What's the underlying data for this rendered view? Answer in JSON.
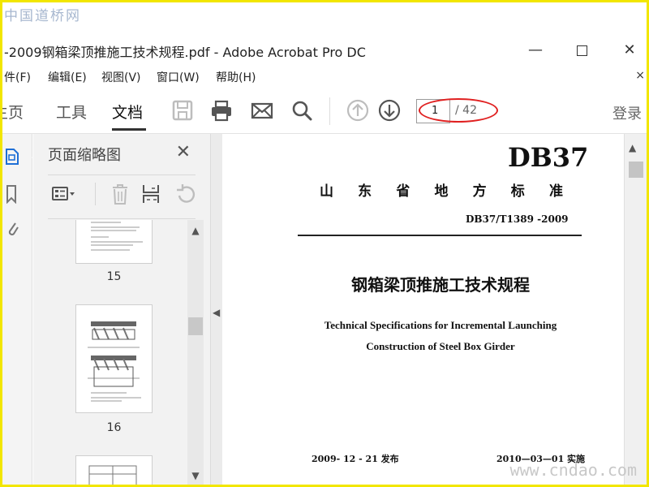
{
  "watermarks": {
    "top_left": "中国道桥网",
    "bottom_right": "www.cndao.com"
  },
  "window": {
    "title": "-2009钢箱梁顶推施工技术规程.pdf - Adobe Acrobat Pro DC",
    "minimize": "—",
    "close": "✕"
  },
  "menu": {
    "items": [
      "件(F)",
      "编辑(E)",
      "视图(V)",
      "窗口(W)",
      "帮助(H)"
    ],
    "close": "×"
  },
  "toolbar": {
    "tabs": [
      "主页",
      "工具",
      "文档"
    ],
    "active_tab": "文档",
    "tools": [
      "save-icon",
      "print-icon",
      "mail-icon",
      "search-icon",
      "page-up-icon",
      "page-down-icon"
    ],
    "page_current": "1",
    "page_total": "/ 42",
    "login": "登录"
  },
  "nav_panel": {
    "title": "页面缩略图",
    "close": "✕",
    "thumbnails": [
      {
        "label": "15"
      },
      {
        "label": "16"
      }
    ]
  },
  "document": {
    "code_big": "DB37",
    "standard_chars": [
      "山",
      "东",
      "省",
      "地",
      "方",
      "标",
      "准"
    ],
    "code": "DB37/T1389 -2009",
    "title_cn": "钢箱梁顶推施工技术规程",
    "title_en_line1": "Technical Specifications for Incremental Launching",
    "title_en_line2": "Construction of Steel Box Girder",
    "release_date": "2009- 12 - 21  发布",
    "effective_date": "2010—03—01  实施"
  },
  "colors": {
    "frame": "#f2e600",
    "annotation_ellipse": "#e02020",
    "panel_bg": "#f2f2f2"
  }
}
